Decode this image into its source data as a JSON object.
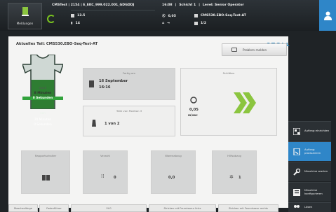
{
  "topbar": {
    "messages_label": "Meldungen",
    "machine": "CMSTest | 2154 | E_EKC_999.022.001_GDGDDJ",
    "time": "16:08",
    "shift": "Schicht 1",
    "level": "Level: Senior Operator",
    "counter_a": "13.5",
    "counter_b": "14",
    "counter_c": "0,05",
    "program": "CMS530.EBO-Seq-Test-AT",
    "page": "1/2"
  },
  "main": {
    "current_part": "Aktuelles Teil: CMS530.EBO-Seq-Test-AT",
    "brand": "STOLL",
    "report_button": "Problem melden",
    "shirt": {
      "line1": "noch",
      "line2": "8 Minuten",
      "line3": "0 Sekunden",
      "line4": "von",
      "line5": "20 Minuten",
      "line6": "0 Sekunden"
    },
    "ready_card": {
      "title": "Fertig am",
      "date": "16 September",
      "time": "16:16"
    },
    "parts_card": {
      "title": "Teile von Position 3",
      "value": "1 von 2"
    },
    "carriage_card": {
      "title": "Schlitten",
      "speed": "0,05",
      "unit": "m/sec"
    },
    "bottom_cards": [
      {
        "title": "Rapportschalter",
        "value": ""
      },
      {
        "title": "Verzahl",
        "value": "0"
      },
      {
        "title": "Warenabzug",
        "value": "0,0"
      },
      {
        "title": "Hilfsabzug",
        "value": "1"
      }
    ],
    "bottom_tabs": [
      "Maschenlänge",
      "Fadenführer",
      "VLG",
      "Stricken mit Fournisseur links",
      "Stricken mit Fournisseur rechts"
    ]
  },
  "sidebar": {
    "items": [
      {
        "label": "Auftrag einrichten"
      },
      {
        "label": "Auftrag produzieren"
      },
      {
        "label": "Maschine warten"
      },
      {
        "label": "Maschine konfigurieren"
      },
      {
        "label": "Lösen"
      }
    ]
  },
  "colors": {
    "accent": "#2f86c8",
    "green": "#7ac41f",
    "shirt_green": "#2e7d32"
  }
}
